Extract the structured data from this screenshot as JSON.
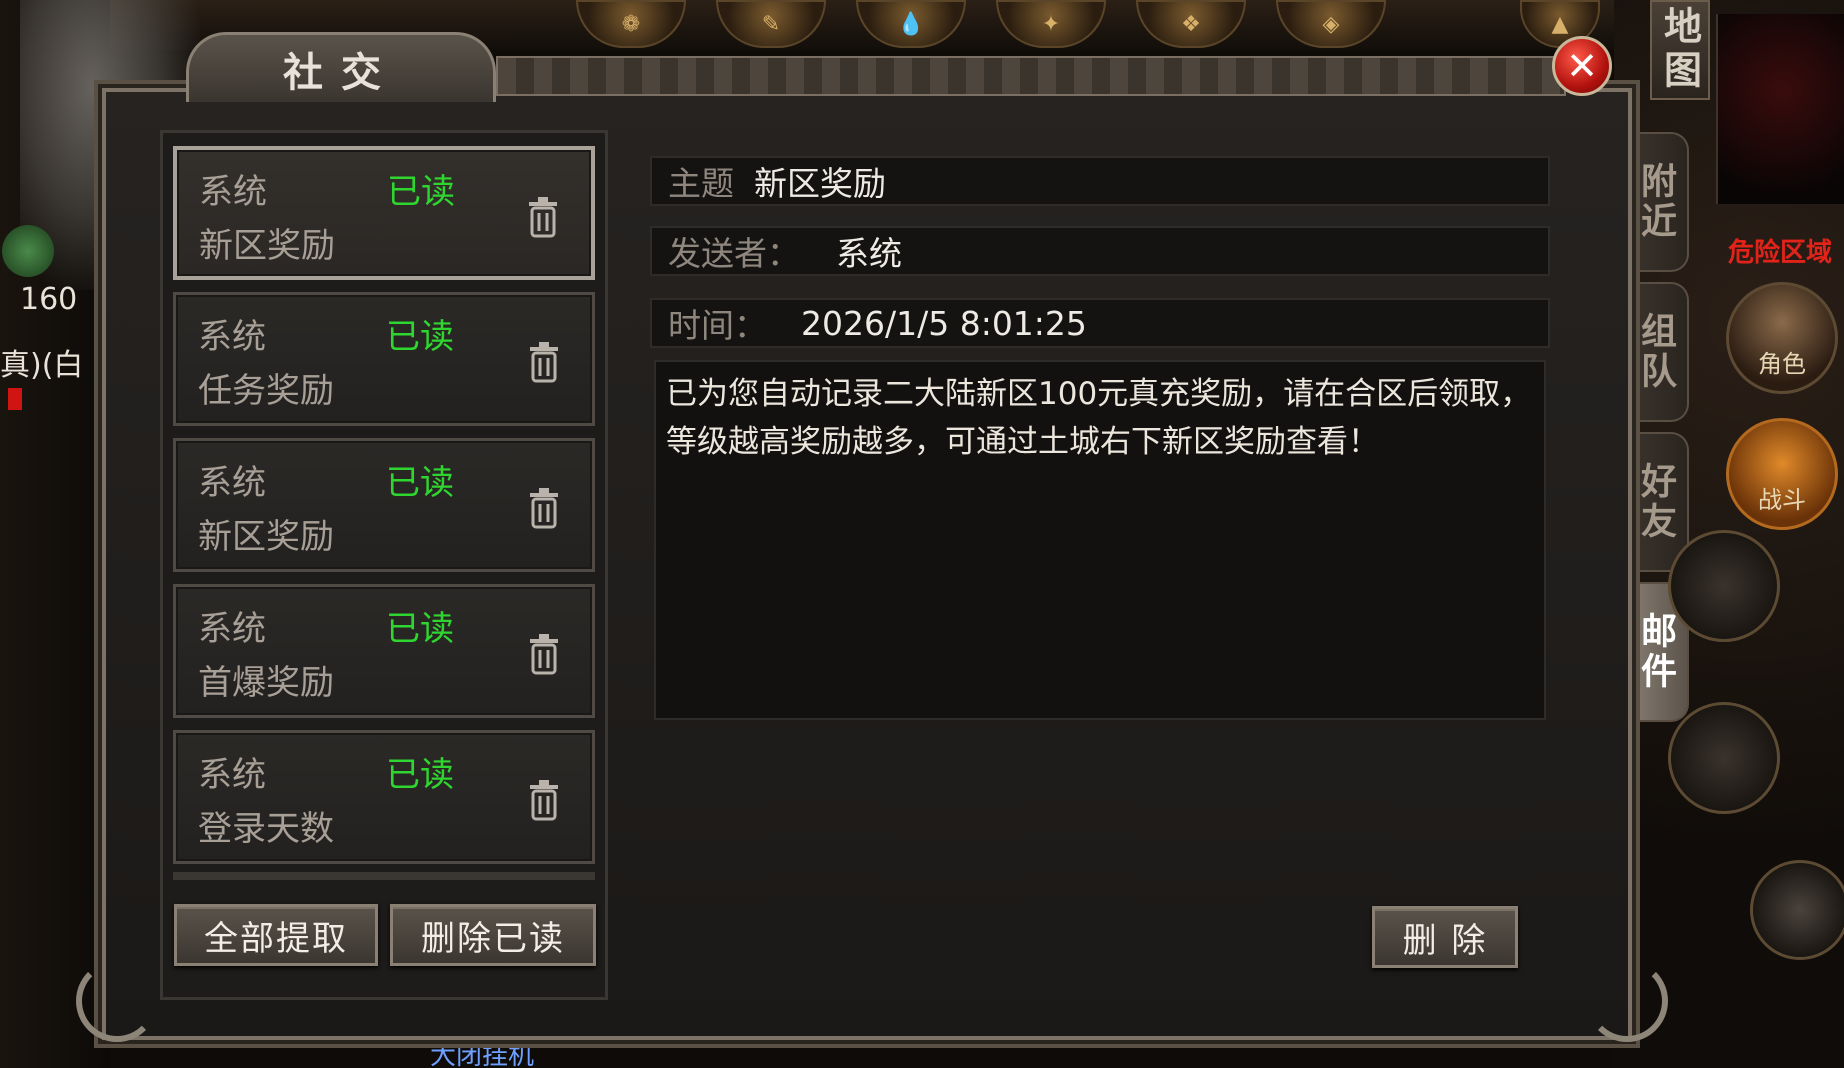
{
  "window": {
    "title": "社交",
    "close_glyph": "✕"
  },
  "top_bar": {
    "icons": [
      "chest-icon",
      "scroll-icon",
      "potion-icon",
      "treasure-icon",
      "gift-icon",
      "coin-icon"
    ],
    "map_label": "地图"
  },
  "side_tabs": [
    {
      "label": "附近",
      "active": false
    },
    {
      "label": "组队",
      "active": false
    },
    {
      "label": "好友",
      "active": false
    },
    {
      "label": "邮件",
      "active": true
    }
  ],
  "right_hud": {
    "danger_text": "危险区域",
    "character_label": "角色",
    "battle_label": "战斗"
  },
  "left_hud": {
    "level": "160",
    "name_fragment": "真)(白"
  },
  "bottom_strip": "大闭挂机",
  "mail_list": [
    {
      "sender": "系统",
      "status": "已读",
      "subject": "新区奖励",
      "selected": true
    },
    {
      "sender": "系统",
      "status": "已读",
      "subject": "任务奖励",
      "selected": false
    },
    {
      "sender": "系统",
      "status": "已读",
      "subject": "新区奖励",
      "selected": false
    },
    {
      "sender": "系统",
      "status": "已读",
      "subject": "首爆奖励",
      "selected": false
    },
    {
      "sender": "系统",
      "status": "已读",
      "subject": "登录天数",
      "selected": false
    }
  ],
  "list_buttons": {
    "claim_all": "全部提取",
    "delete_read": "删除已读"
  },
  "detail": {
    "subject_label": "主题",
    "subject_value": "新区奖励",
    "sender_label": "发送者：",
    "sender_value": "系统",
    "time_label": "时间：",
    "time_value": "2026/1/5 8:01:25",
    "body": "已为您自动记录二大陆新区100元真充奖励，请在合区后领取，等级越高奖励越多，可通过土城右下新区奖励查看！",
    "delete_label": "删 除"
  },
  "colors": {
    "read_status": "#2fd62f",
    "danger": "#e2231a",
    "close_button": "#c8140f"
  }
}
